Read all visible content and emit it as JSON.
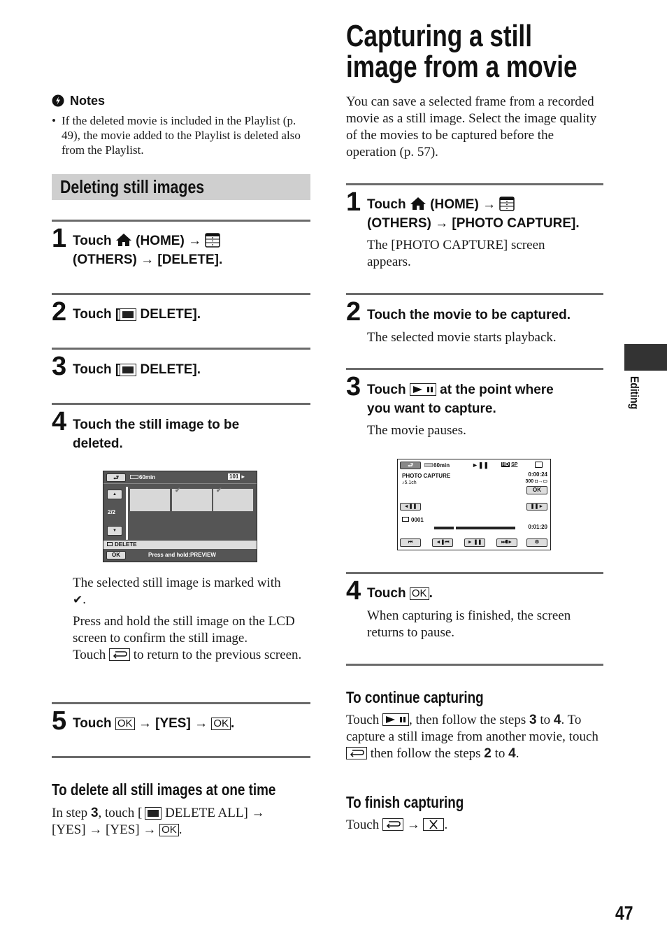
{
  "page_number": "47",
  "side_tab": {
    "label": "Editing"
  },
  "notes": {
    "heading": "Notes",
    "bullets": [
      "If the deleted movie is included in the Playlist (p. 49), the movie added to the Playlist is deleted also from the Playlist."
    ]
  },
  "deleting": {
    "section_title": "Deleting still images",
    "steps": [
      {
        "num": "1",
        "t1": "Touch",
        "t2": "(HOME) →",
        "t3": "(OTHERS) → [DELETE]."
      },
      {
        "num": "2",
        "t1": "Touch [",
        "t2": "DELETE]."
      },
      {
        "num": "3",
        "t1": "Touch [",
        "t2": "DELETE]."
      },
      {
        "num": "4",
        "t1": "Touch the still image to be",
        "t2": "deleted."
      },
      {
        "num": "5",
        "t1": "Touch",
        "ok1": "OK",
        "t2": "→ [YES] →",
        "ok2": "OK",
        "t3": "."
      }
    ],
    "screen": {
      "battery": "60min",
      "folder": "101",
      "page": "2/2",
      "mode": "DELETE",
      "ok": "OK",
      "hint": "Press and hold:PREVIEW",
      "thumbs": [
        {
          "checked": false
        },
        {
          "checked": true
        },
        {
          "checked": true
        }
      ]
    },
    "after_step4": {
      "p1": "The selected still image is marked with",
      "p1b": ".",
      "p2": "Press and hold the still image on the LCD screen to confirm the still image.",
      "p3a": "Touch",
      "p3b": "to return to the previous screen."
    },
    "delete_all": {
      "heading": "To delete all still images at one time",
      "a": "In step",
      "b": "3",
      "c": ", touch [",
      "d": "DELETE ALL] →",
      "e": "[YES] → [YES] →",
      "ok": "OK",
      "f": "."
    }
  },
  "capturing": {
    "title_line1": "Capturing a still",
    "title_line2": "image from a movie",
    "intro": "You can save a selected frame from a recorded movie as a still image. Select the image quality of the movies to be captured before the operation (p. 57).",
    "steps": [
      {
        "num": "1",
        "t1": "Touch",
        "t2": "(HOME) →",
        "t3": "(OTHERS) → [PHOTO CAPTURE].",
        "desc": "The [PHOTO CAPTURE] screen appears."
      },
      {
        "num": "2",
        "t1": "Touch the movie to be captured.",
        "desc": "The selected movie starts playback."
      },
      {
        "num": "3",
        "t1": "Touch",
        "t2": "at the point where",
        "t3": "you want to capture.",
        "desc": "The movie pauses."
      },
      {
        "num": "4",
        "t1": "Touch",
        "ok": "OK",
        "t2": ".",
        "desc": "When capturing is finished, the screen returns to pause."
      }
    ],
    "screen": {
      "battery": "60min",
      "quality": "SP",
      "title": "PHOTO CAPTURE",
      "audio": "♪5.1ch",
      "time_current": "0:00:24",
      "remaining": "300",
      "ok": "OK",
      "frame": "0001",
      "time_total": "0:01:20",
      "progress": 0.24
    },
    "continue": {
      "heading": "To continue capturing",
      "a": "Touch",
      "b": ", then follow the steps",
      "s1": "3",
      "c": "to",
      "s2": "4",
      "d": ".",
      "e": "To capture a still image from another movie, touch",
      "f": "then follow the steps",
      "s3": "2",
      "g": "to",
      "s4": "4",
      "h": "."
    },
    "finish": {
      "heading": "To finish capturing",
      "a": "Touch",
      "arrow": "→",
      "end": "."
    }
  }
}
